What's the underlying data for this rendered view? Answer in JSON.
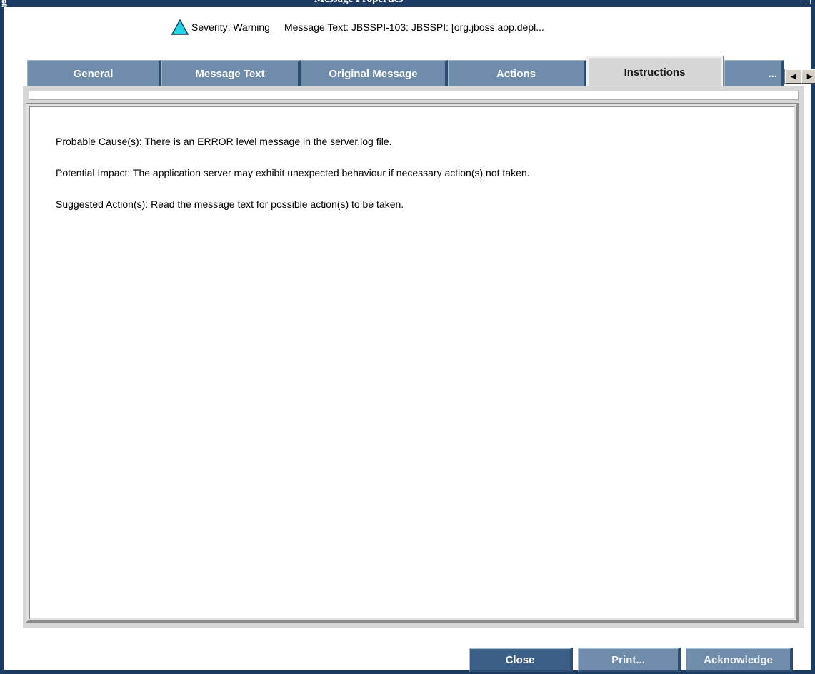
{
  "window": {
    "title": "Message Properties"
  },
  "summary": {
    "severity": "Severity: Warning",
    "message_text": "Message Text: JBSSPI-103: JBSSPI:  [org.jboss.aop.depl..."
  },
  "tabs": [
    {
      "label": "General"
    },
    {
      "label": "Message Text"
    },
    {
      "label": "Original Message"
    },
    {
      "label": "Actions"
    },
    {
      "label": "Instructions"
    },
    {
      "label": "..."
    }
  ],
  "active_tab": "Instructions",
  "instructions": {
    "probable_cause": "Probable Cause(s): There is an ERROR level message in the server.log file.",
    "potential_impact": "Potential Impact: The application server may exhibit unexpected behaviour if necessary action(s) not taken.",
    "suggested_action": "Suggested Action(s): Read the message text for possible action(s) to be taken."
  },
  "buttons": {
    "close": "Close",
    "print": "Print...",
    "acknowledge": "Acknowledge"
  },
  "icons": {
    "severity": "warning-triangle-icon",
    "scroll_left": "arrow-left-icon",
    "scroll_right": "arrow-right-icon"
  },
  "colors": {
    "tab_bg": "#6f8caa",
    "warning": "#22d3e6"
  }
}
